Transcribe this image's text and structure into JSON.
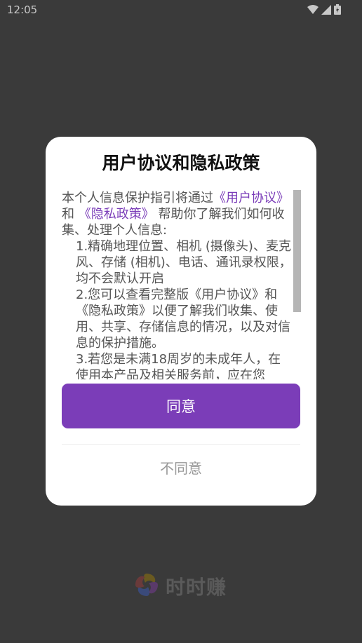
{
  "status_bar": {
    "time": "12:05"
  },
  "dialog": {
    "title": "用户协议和隐私政策",
    "body": {
      "intro_prefix": "本个人信息保护指引将通过",
      "link_user_agreement": "《用户协议》",
      "and": "和",
      "link_privacy_policy": "《隐私政策》",
      "intro_suffix": "帮助你了解我们如何收集、处理个人信息:",
      "item1": "1.精确地理位置、相机 (摄像头)、麦克风、存储 (相机)、电话、通讯录权限，均不会默认开启",
      "item2": "2.您可以查看完整版《用户协议》和《隐私政策》以便了解我们收集、使用、共享、存储信息的情况，以及对信息的保护措施。",
      "item3": "3.若您是未满18周岁的未成年人，在使用本产品及相关服务前，应在您"
    },
    "agree_label": "同意",
    "disagree_label": "不同意"
  },
  "brand": {
    "name": "时时赚"
  },
  "colors": {
    "accent": "#7b3db8",
    "link": "#7a3cb8",
    "overlay": "#3a3a3a"
  },
  "icons": [
    "wifi-icon",
    "signal-icon",
    "battery-icon",
    "brand-logo-icon"
  ]
}
